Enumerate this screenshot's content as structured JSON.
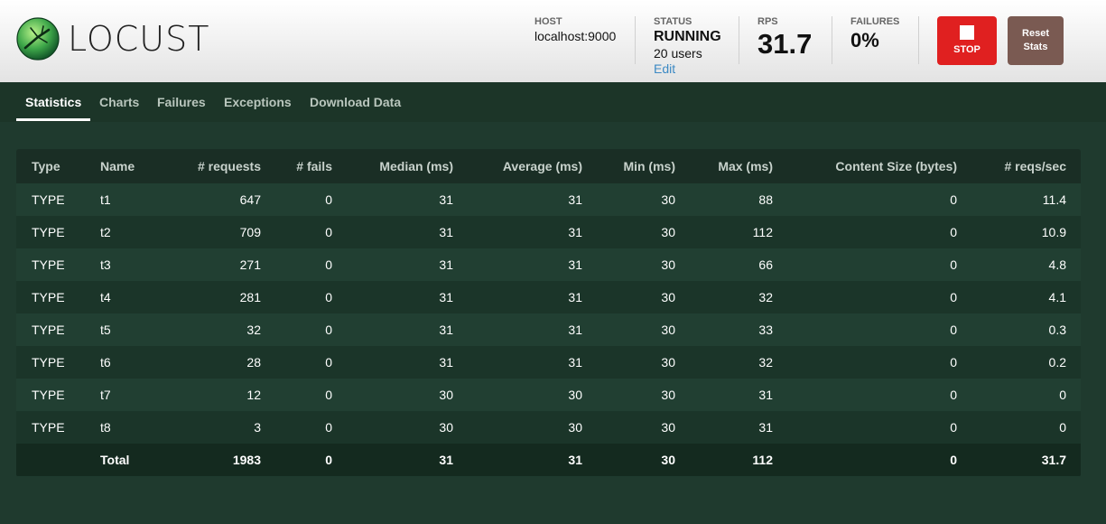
{
  "app": {
    "logo_text": "LOCUST"
  },
  "header": {
    "host": {
      "label": "HOST",
      "value": "localhost:9000"
    },
    "status": {
      "label": "STATUS",
      "value": "RUNNING",
      "users": "20 users",
      "edit": "Edit"
    },
    "rps": {
      "label": "RPS",
      "value": "31.7"
    },
    "failures": {
      "label": "FAILURES",
      "value": "0%"
    },
    "stop_label": "STOP",
    "reset_label_1": "Reset",
    "reset_label_2": "Stats"
  },
  "tabs": [
    "Statistics",
    "Charts",
    "Failures",
    "Exceptions",
    "Download Data"
  ],
  "table": {
    "columns": [
      "Type",
      "Name",
      "# requests",
      "# fails",
      "Median (ms)",
      "Average (ms)",
      "Min (ms)",
      "Max (ms)",
      "Content Size (bytes)",
      "# reqs/sec"
    ],
    "rows": [
      [
        "TYPE",
        "t1",
        "647",
        "0",
        "31",
        "31",
        "30",
        "88",
        "0",
        "11.4"
      ],
      [
        "TYPE",
        "t2",
        "709",
        "0",
        "31",
        "31",
        "30",
        "112",
        "0",
        "10.9"
      ],
      [
        "TYPE",
        "t3",
        "271",
        "0",
        "31",
        "31",
        "30",
        "66",
        "0",
        "4.8"
      ],
      [
        "TYPE",
        "t4",
        "281",
        "0",
        "31",
        "31",
        "30",
        "32",
        "0",
        "4.1"
      ],
      [
        "TYPE",
        "t5",
        "32",
        "0",
        "31",
        "31",
        "30",
        "33",
        "0",
        "0.3"
      ],
      [
        "TYPE",
        "t6",
        "28",
        "0",
        "31",
        "31",
        "30",
        "32",
        "0",
        "0.2"
      ],
      [
        "TYPE",
        "t7",
        "12",
        "0",
        "30",
        "30",
        "30",
        "31",
        "0",
        "0"
      ],
      [
        "TYPE",
        "t8",
        "3",
        "0",
        "30",
        "30",
        "30",
        "31",
        "0",
        "0"
      ]
    ],
    "total": [
      "",
      "Total",
      "1983",
      "0",
      "31",
      "31",
      "30",
      "112",
      "0",
      "31.7"
    ]
  },
  "colors": {
    "background": "#1f3a2e",
    "stop": "#e02020",
    "reset": "#7a5a52",
    "link": "#3d8ac4"
  }
}
